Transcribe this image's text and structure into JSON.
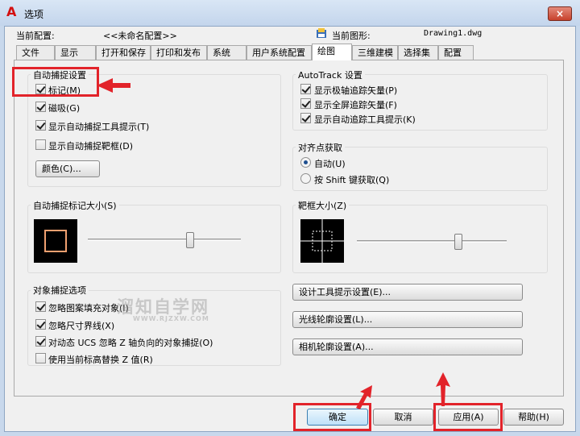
{
  "window": {
    "title": "选项",
    "close_glyph": "×"
  },
  "header": {
    "profile_label": "当前配置:",
    "profile_value": "<<未命名配置>>",
    "drawing_label": "当前图形:",
    "drawing_value": "Drawing1.dwg"
  },
  "tabs": [
    "文件",
    "显示",
    "打开和保存",
    "打印和发布",
    "系统",
    "用户系统配置",
    "绘图",
    "三维建模",
    "选择集",
    "配置"
  ],
  "active_tab": "绘图",
  "autosnap": {
    "title": "自动捕捉设置",
    "options": [
      {
        "label": "标记(M)",
        "checked": true
      },
      {
        "label": "磁吸(G)",
        "checked": true
      },
      {
        "label": "显示自动捕捉工具提示(T)",
        "checked": true
      },
      {
        "label": "显示自动捕捉靶框(D)",
        "checked": false
      }
    ],
    "color_button": "颜色(C)..."
  },
  "autotrack": {
    "title": "AutoTrack 设置",
    "options": [
      {
        "label": "显示极轴追踪矢量(P)",
        "checked": true
      },
      {
        "label": "显示全屏追踪矢量(F)",
        "checked": true
      },
      {
        "label": "显示自动追踪工具提示(K)",
        "checked": true
      }
    ]
  },
  "alignment": {
    "title": "对齐点获取",
    "options": [
      {
        "label": "自动(U)",
        "selected": true
      },
      {
        "label": "按 Shift 键获取(Q)",
        "selected": false
      }
    ]
  },
  "marker_size": {
    "title": "自动捕捉标记大小(S)",
    "value_fraction": 0.67
  },
  "aperture_size": {
    "title": "靶框大小(Z)",
    "value_fraction": 0.68
  },
  "osnap": {
    "title": "对象捕捉选项",
    "options": [
      {
        "label": "忽略图案填充对象(I)",
        "checked": true
      },
      {
        "label": "忽略尺寸界线(X)",
        "checked": true
      },
      {
        "label": "对动态 UCS 忽略 Z 轴负向的对象捕捉(O)",
        "checked": true
      },
      {
        "label": "使用当前标高替换 Z 值(R)",
        "checked": false
      }
    ]
  },
  "right_buttons": [
    "设计工具提示设置(E)...",
    "光线轮廓设置(L)...",
    "相机轮廓设置(A)..."
  ],
  "footer": {
    "ok": "确定",
    "cancel": "取消",
    "apply": "应用(A)",
    "help": "帮助(H)"
  },
  "watermark": {
    "line1": "溜知自学网",
    "line2": "WWW.RJZXW.COM"
  },
  "colors": {
    "annotation": "#e2232a",
    "marker_preview": "#f0a070"
  }
}
